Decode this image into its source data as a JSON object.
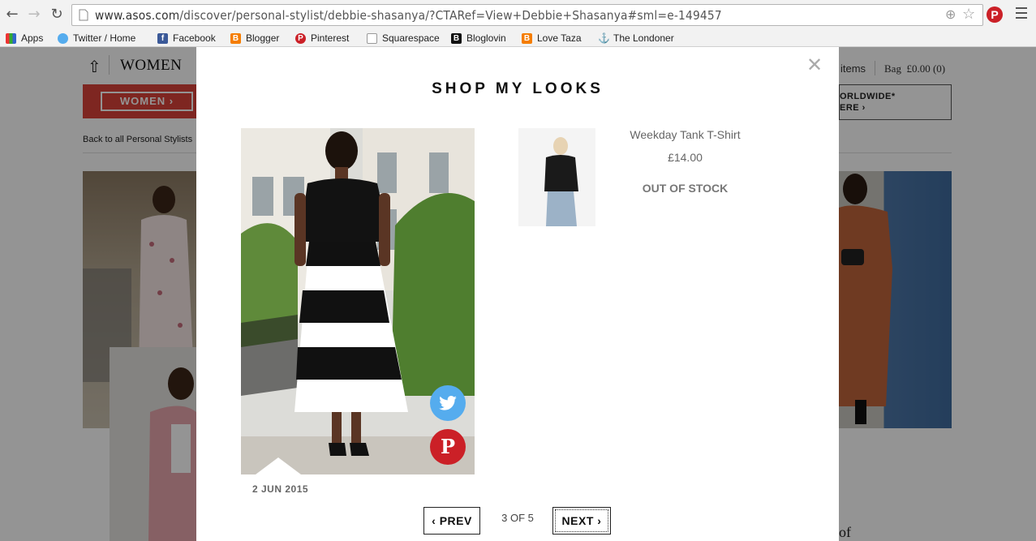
{
  "browser": {
    "url_host": "www.asos.com",
    "url_path": "/discover/personal-stylist/debbie-shasanya/?CTARef=View+Debbie+Shasanya#sml=e-149457",
    "bookmarks": [
      "Apps",
      "Twitter / Home",
      "Facebook",
      "Blogger",
      "Pinterest",
      "Squarespace",
      "Bloglovin",
      "Love Taza",
      "The Londoner"
    ]
  },
  "site": {
    "nav_women": "WOMEN",
    "women_button": "WOMEN ›",
    "saved_items": "items",
    "bag_label": "Bag",
    "bag_total": "£0.00",
    "bag_count": "(0)",
    "promo_line1": "ORLDWIDE*",
    "promo_line2": "ERE ›",
    "back_link": "Back to all Personal Stylists",
    "bottom_fragment": "of"
  },
  "modal": {
    "title": "SHOP MY LOOKS",
    "date": "2 JUN 2015",
    "product": {
      "name": "Weekday Tank T-Shirt",
      "price": "£14.00",
      "status": "OUT OF STOCK"
    },
    "pager": {
      "prev_label": "PREV",
      "position": "3 OF 5",
      "next_label": "NEXT"
    }
  },
  "colors": {
    "twitter": "#55acee",
    "pinterest": "#cb2027",
    "asos_red": "#d9433a"
  }
}
